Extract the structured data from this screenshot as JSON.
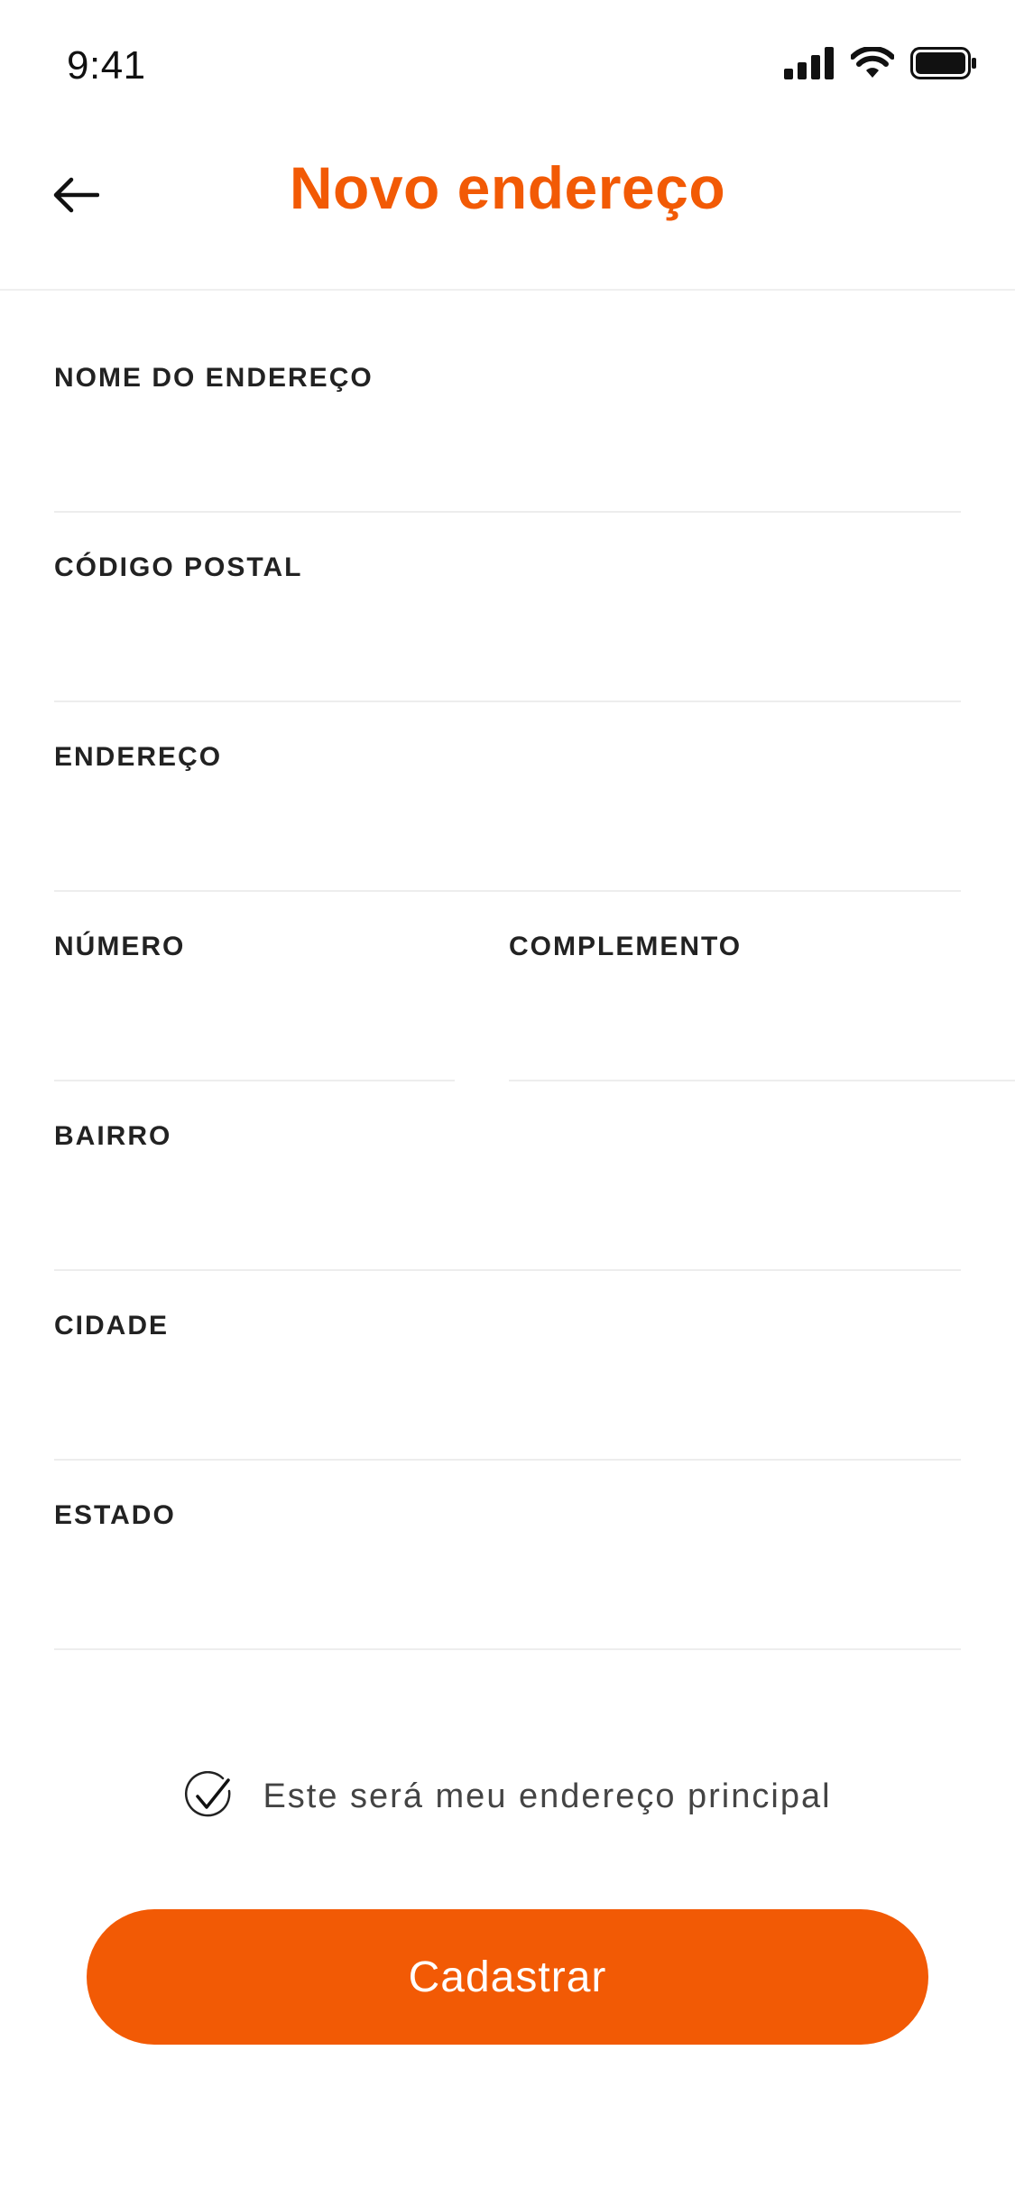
{
  "status_bar": {
    "time": "9:41",
    "icons": [
      "signal-icon",
      "wifi-icon",
      "battery-icon"
    ]
  },
  "header": {
    "title": "Novo endereço",
    "back_icon": "arrow-left-icon"
  },
  "form": {
    "nome": {
      "label": "NOME DO ENDEREÇO",
      "value": "",
      "placeholder": ""
    },
    "cep": {
      "label": "CÓDIGO POSTAL",
      "value": "",
      "placeholder": ""
    },
    "endereco": {
      "label": "ENDEREÇO",
      "value": "",
      "placeholder": ""
    },
    "numero": {
      "label": "NÚMERO",
      "value": "",
      "placeholder": ""
    },
    "complemento": {
      "label": "COMPLEMENTO",
      "value": "",
      "placeholder": ""
    },
    "bairro": {
      "label": "BAIRRO",
      "value": "",
      "placeholder": ""
    },
    "cidade": {
      "label": "CIDADE",
      "value": "",
      "placeholder": ""
    },
    "estado": {
      "label": "ESTADO",
      "value": "",
      "placeholder": ""
    }
  },
  "principal": {
    "label": "Este será meu endereço principal",
    "checked": true,
    "icon": "check-circle-icon"
  },
  "submit": {
    "label": "Cadastrar"
  },
  "colors": {
    "accent": "#F25A05",
    "text": "#222222",
    "divider": "#EDEDED"
  }
}
